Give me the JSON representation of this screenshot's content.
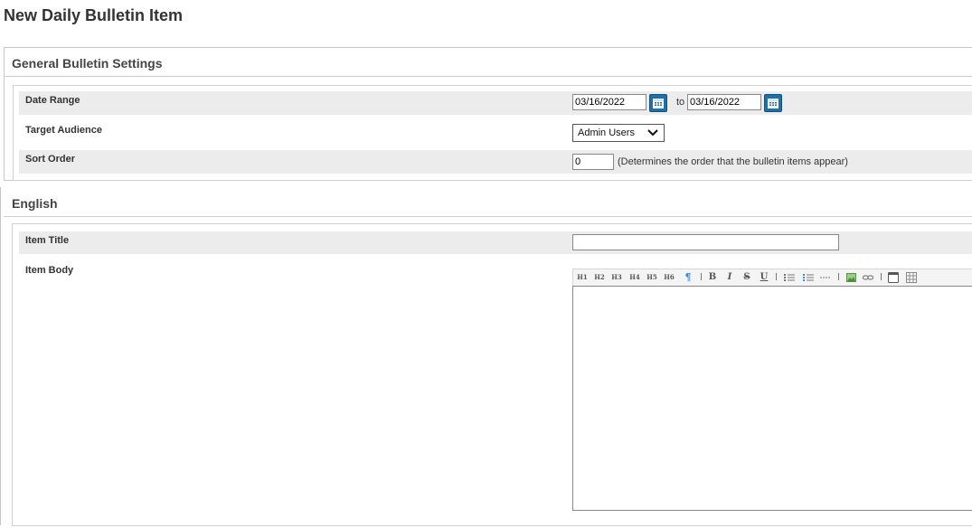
{
  "page": {
    "title": "New Daily Bulletin Item"
  },
  "general": {
    "heading": "General Bulletin Settings",
    "date_range": {
      "label": "Date Range",
      "from": "03/16/2022",
      "to_label": "to",
      "to": "03/16/2022",
      "calendar_icon": "calendar-icon"
    },
    "target_audience": {
      "label": "Target Audience",
      "value": "Admin Users"
    },
    "sort_order": {
      "label": "Sort Order",
      "value": "0",
      "hint": "(Determines the order that the bulletin items appear)"
    }
  },
  "english": {
    "heading": "English",
    "item_title": {
      "label": "Item Title",
      "value": ""
    },
    "item_body": {
      "label": "Item Body",
      "value": ""
    },
    "toolbar": [
      "H1",
      "H2",
      "H3",
      "H4",
      "H5",
      "H6",
      "paragraph",
      "bold",
      "italic",
      "strikethrough",
      "underline",
      "unordered-list",
      "ordered-list",
      "horizontal-rule",
      "image",
      "link",
      "source",
      "table"
    ]
  },
  "colors": {
    "row_shade": "#ececec",
    "calendar_button": "#1f6fa8",
    "border": "#c8c8c8"
  }
}
